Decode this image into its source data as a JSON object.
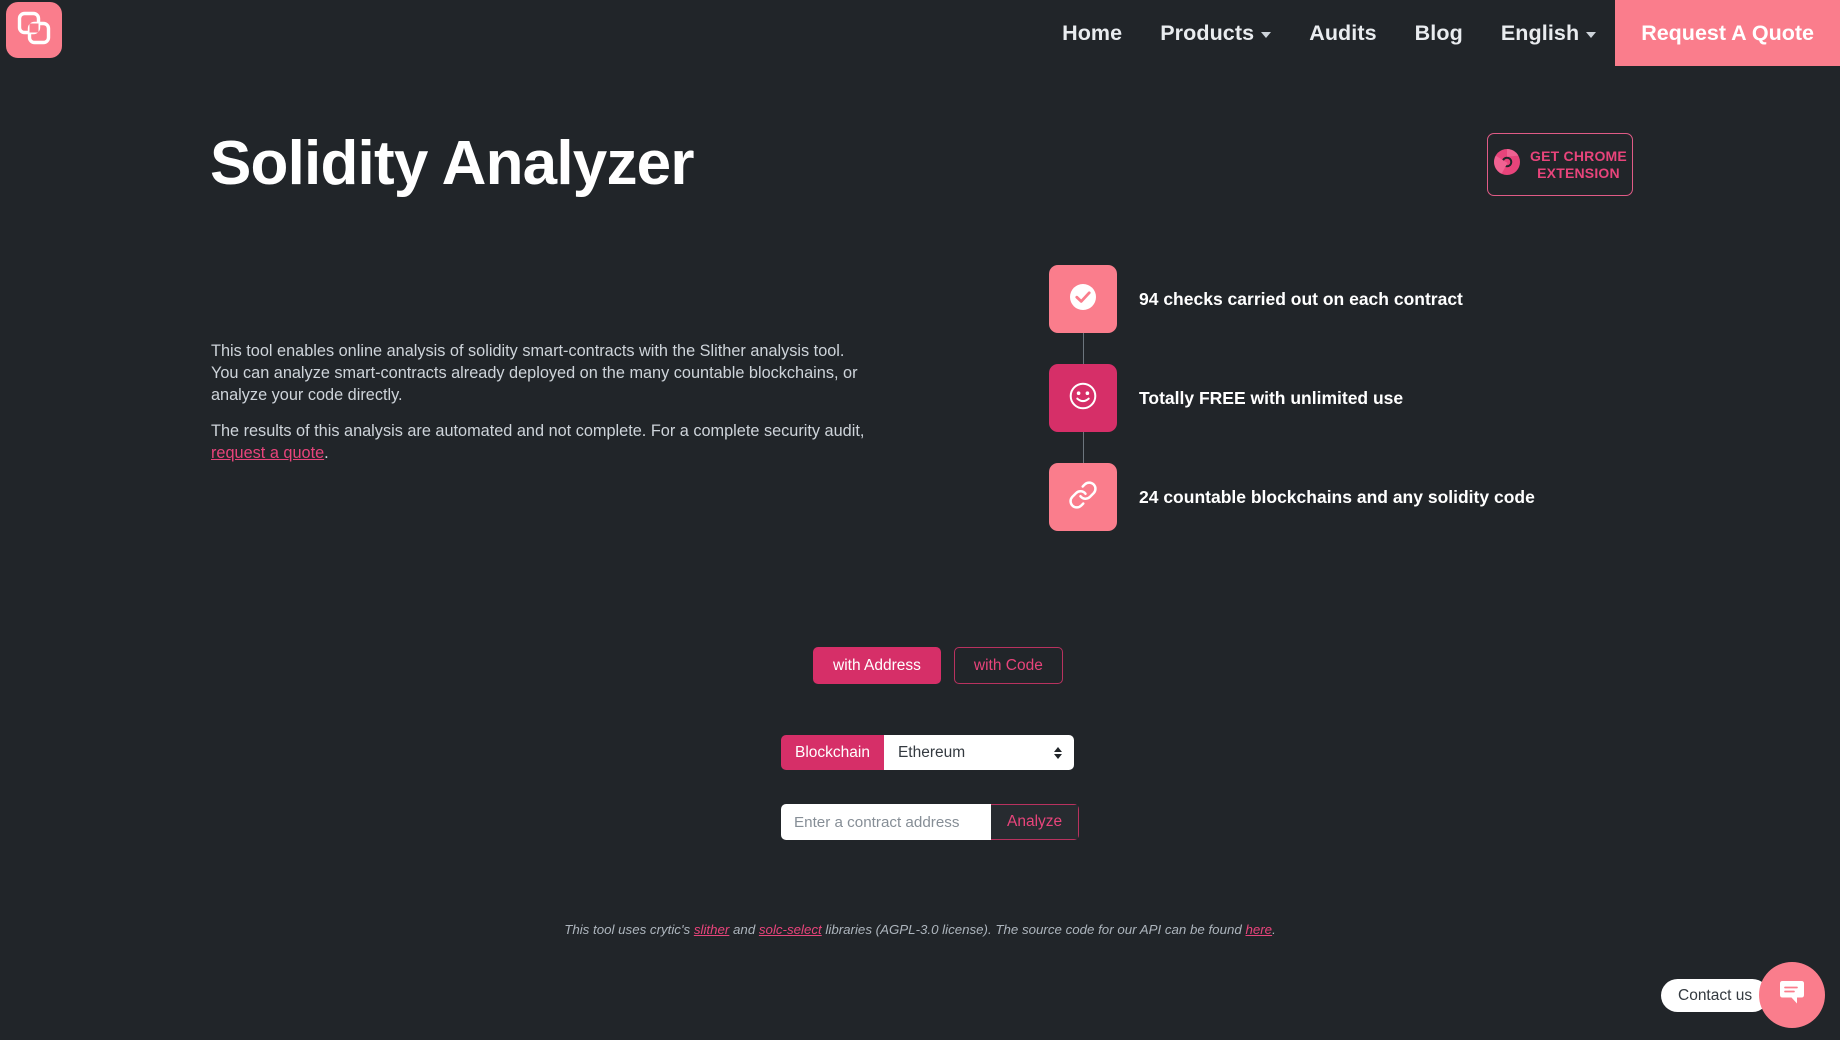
{
  "colors": {
    "background": "#212529",
    "accent_light": "#fa7d8c",
    "accent_dark": "#d62f68",
    "accent_link": "#e8447b",
    "text_primary": "#ffffff",
    "text_muted": "#ced4da"
  },
  "header": {
    "logo_name": "overlapping-squares-logo",
    "nav": [
      {
        "label": "Home",
        "has_caret": false
      },
      {
        "label": "Products",
        "has_caret": true
      },
      {
        "label": "Audits",
        "has_caret": false
      },
      {
        "label": "Blog",
        "has_caret": false
      },
      {
        "label": "English",
        "has_caret": true
      }
    ],
    "cta_label": "Request A Quote"
  },
  "hero": {
    "title": "Solidity Analyzer",
    "chrome_button": {
      "line1": "GET CHROME",
      "line2": "EXTENSION",
      "icon": "chrome-icon"
    }
  },
  "description": {
    "paragraph1_a": "This tool enables online analysis of solidity smart-contracts with the Slither analysis tool. You can analyze smart-contracts already deployed on the many countable blockchains, or analyze your code directly.",
    "paragraph2_a": "The results of this analysis are automated and not complete. For a complete security audit, ",
    "paragraph2_link": "request a quote",
    "paragraph2_b": "."
  },
  "features": [
    {
      "icon": "check-circle-icon",
      "tone": "light",
      "text": "94 checks carried out on each contract"
    },
    {
      "icon": "smiley-face-icon",
      "tone": "dark",
      "text": "Totally FREE with unlimited use"
    },
    {
      "icon": "link-chain-icon",
      "tone": "light",
      "text": "24 countable blockchains and any solidity code"
    }
  ],
  "form": {
    "tabs": [
      {
        "label": "with Address",
        "active": true
      },
      {
        "label": "with Code",
        "active": false
      }
    ],
    "blockchain_label": "Blockchain",
    "blockchain_selected": "Ethereum",
    "address_placeholder": "Enter a contract address",
    "address_value": "",
    "analyze_label": "Analyze"
  },
  "footer": {
    "text_a": "This tool uses crytic's ",
    "link1": "slither",
    "text_b": " and ",
    "link2": "solc-select",
    "text_c": " libraries (AGPL-3.0 license). The source code for our API can be found ",
    "link3": "here",
    "text_d": "."
  },
  "chat": {
    "pill_label": "Contact us",
    "button_icon": "chat-bubble-icon"
  }
}
